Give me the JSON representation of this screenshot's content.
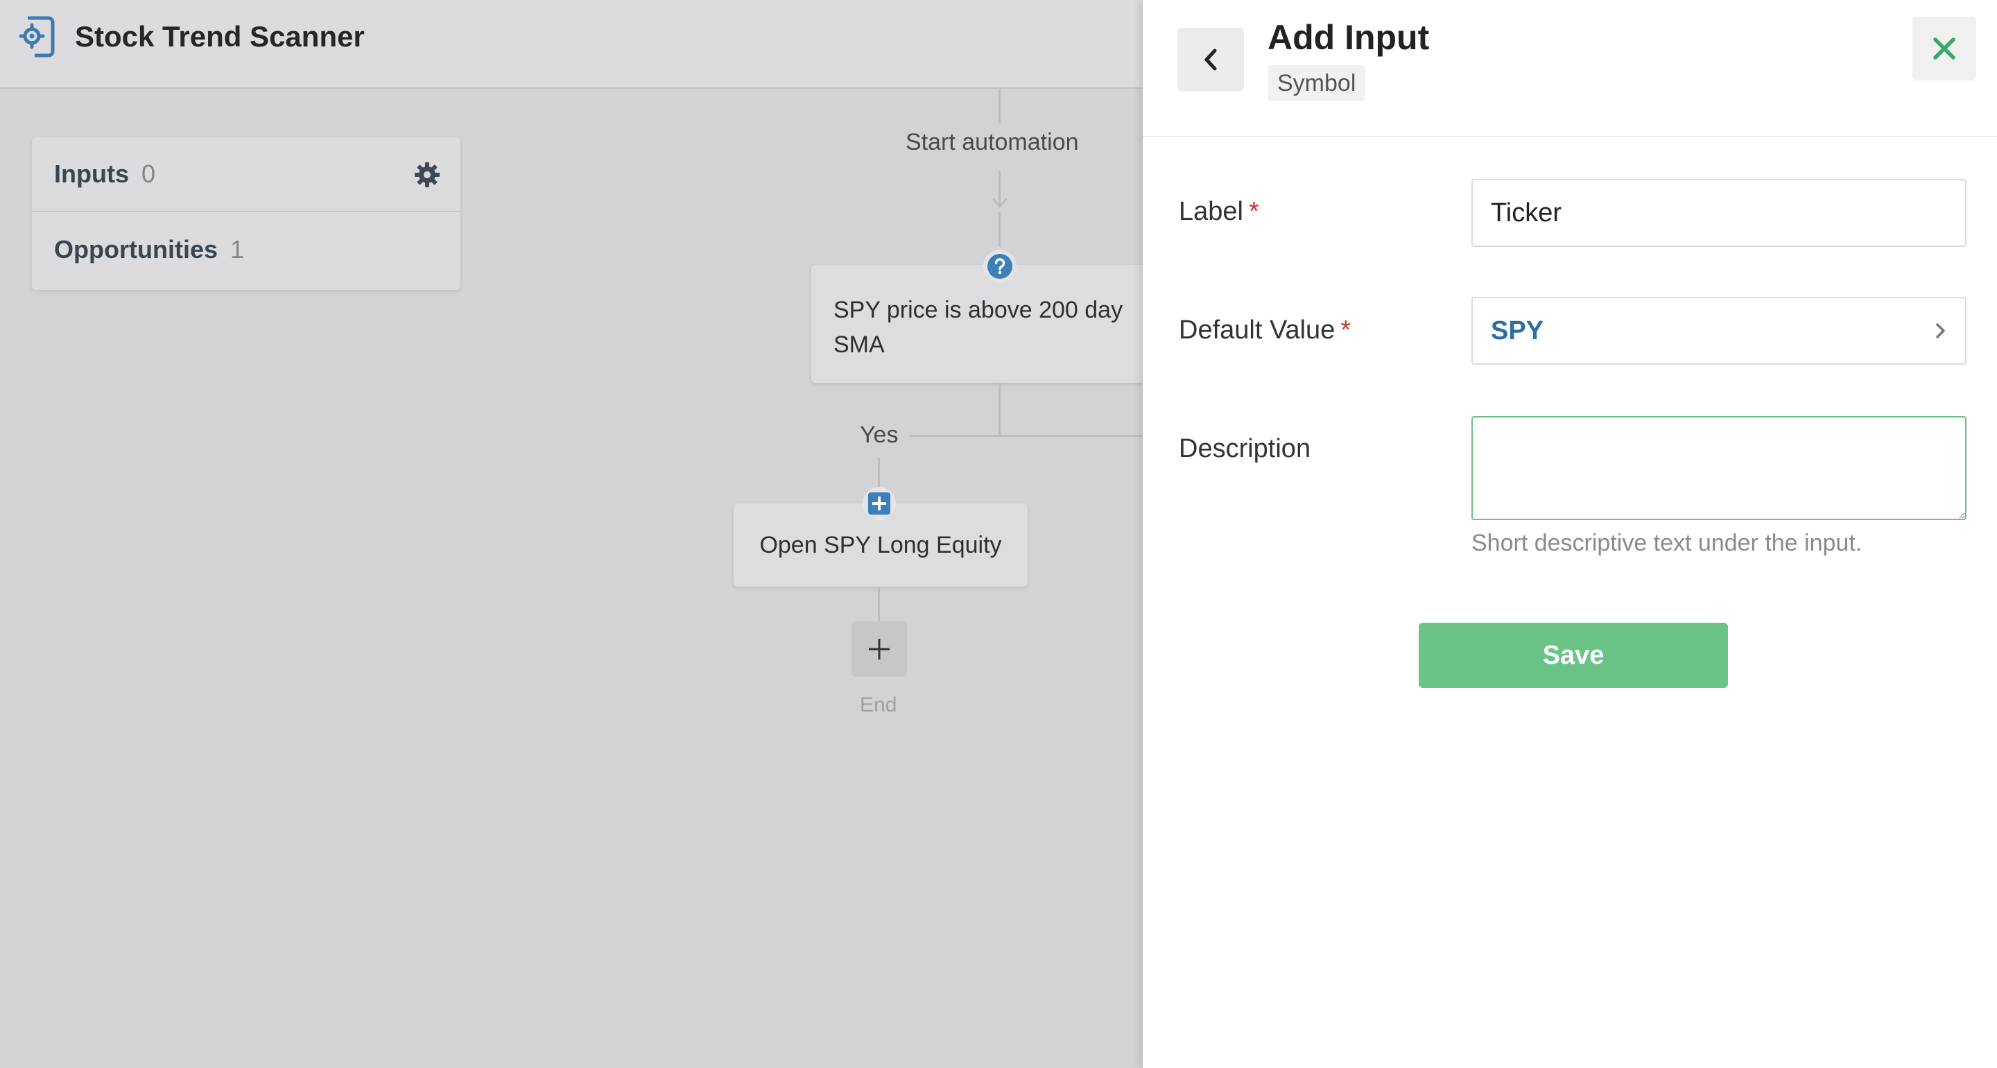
{
  "app": {
    "title": "Stock Trend Scanner",
    "logo_icon": "gear-document-icon"
  },
  "sidebar": {
    "items": [
      {
        "label": "Inputs",
        "count": "0",
        "icon": "gear-icon"
      },
      {
        "label": "Opportunities",
        "count": "1"
      }
    ]
  },
  "flow": {
    "start_label": "Start automation",
    "condition_text": "SPY price is above 200 day SMA",
    "condition_icon": "question-circle-icon",
    "branch_yes_label": "Yes",
    "action_text": "Open SPY Long Equity",
    "action_icon": "plus-square-icon",
    "add_step_icon": "plus-icon",
    "end_label": "End"
  },
  "panel": {
    "title": "Add Input",
    "subtitle": "Symbol",
    "back_icon": "chevron-left-icon",
    "close_icon": "close-icon",
    "fields": {
      "label": {
        "label": "Label",
        "required_mark": "*",
        "value": "Ticker"
      },
      "default_value": {
        "label": "Default Value",
        "required_mark": "*",
        "value": "SPY",
        "icon": "chevron-right-icon"
      },
      "description": {
        "label": "Description",
        "value": "",
        "help": "Short descriptive text under the input."
      }
    },
    "save_label": "Save"
  },
  "colors": {
    "accent_green": "#6ac387",
    "link_blue": "#2e6fa3",
    "close_green": "#3aa76d",
    "required_red": "#c0392b"
  }
}
